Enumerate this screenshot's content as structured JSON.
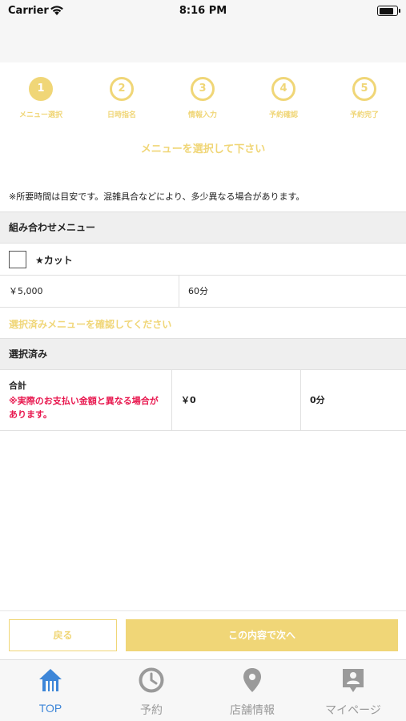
{
  "status_bar": {
    "carrier": "Carrier",
    "time": "8:16 PM"
  },
  "steps": [
    {
      "number": "1",
      "label": "メニュー選択",
      "active": true
    },
    {
      "number": "2",
      "label": "日時指名",
      "active": false
    },
    {
      "number": "3",
      "label": "情報入力",
      "active": false
    },
    {
      "number": "4",
      "label": "予約確認",
      "active": false
    },
    {
      "number": "5",
      "label": "予約完了",
      "active": false
    }
  ],
  "page_title": "メニューを選択して下さい",
  "notice": "※所要時間は目安です。混雑具合などにより、多少異なる場合があります。",
  "combo_menu": {
    "header": "組み合わせメニュー",
    "item": {
      "name": "★カット",
      "price": "￥5,000",
      "duration": "60分"
    }
  },
  "confirm_link": "選択済みメニューを確認してください",
  "selected": {
    "header": "選択済み",
    "total_label": "合計",
    "total_note": "※実際のお支払い金額と異なる場合があります。",
    "total_price": "￥0",
    "total_duration": "0分"
  },
  "buttons": {
    "back": "戻る",
    "next": "この内容で次へ"
  },
  "tab_bar": [
    {
      "label": "TOP",
      "icon": "home-icon",
      "active": true
    },
    {
      "label": "予約",
      "icon": "clock-icon",
      "active": false
    },
    {
      "label": "店舗情報",
      "icon": "map-pin-icon",
      "active": false
    },
    {
      "label": "マイページ",
      "icon": "person-badge-icon",
      "active": false
    }
  ],
  "colors": {
    "accent": "#f0d677",
    "tab_active": "#3d86d8",
    "warning": "#e8174e",
    "tab_inactive": "#9a9a9a"
  }
}
